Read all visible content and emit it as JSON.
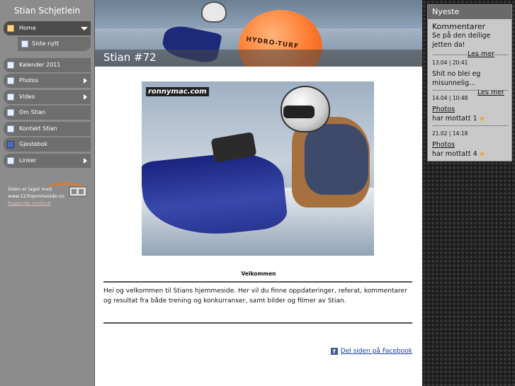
{
  "site": {
    "title": "Stian Schjetlein"
  },
  "nav": {
    "home": "Home",
    "siste_nytt": "Siste nytt",
    "kalender": "Kalender 2011",
    "photos": "Photos",
    "video": "Video",
    "om": "Om Stian",
    "kontakt": "Kontakt Stian",
    "gjestebok": "Gjestebok",
    "linker": "Linker"
  },
  "credit": {
    "line1": "Siden er laget med",
    "line2": "www.123hjemmeside.no",
    "line3": "Rapporter misbruk"
  },
  "banner": {
    "title": "Stian #72",
    "buoy_text": "HYDRO-TURF"
  },
  "photo": {
    "logo": "ronnymac.com"
  },
  "content": {
    "welcome_title": "Velkommen",
    "intro": "Hei og velkommen til Stians hjemmeside. Her vil du finne oppdateringer, referat, kommentarer og resultat fra både trening og konkurranser, samt bilder og filmer av Stian.",
    "share": "Del siden på Facebook"
  },
  "news": {
    "heading": "Nyeste",
    "items": [
      {
        "label": "Kommentarer",
        "text": "Se på den deilige jetten da!",
        "link": "Les mer"
      },
      {
        "date": "13.04 | 20:41",
        "text": "Shit no blei eg misunnelig...",
        "link": "Les mer"
      },
      {
        "date": "14.04 | 10:48",
        "link": "Photos",
        "text": "har mottatt 1"
      },
      {
        "date": "21.02 | 14:18",
        "link": "Photos",
        "text": "har mottatt 4"
      }
    ]
  },
  "colors": {
    "sidebar": "#8c8c8c",
    "nav": "#6e6e6e",
    "link": "#1a3a9a",
    "panel": "#c9c9c9"
  }
}
